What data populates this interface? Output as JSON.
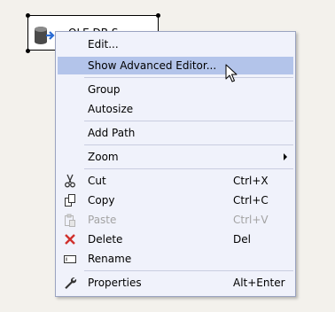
{
  "component": {
    "label": "OLE DB S"
  },
  "menu": {
    "edit": {
      "label": "Edit..."
    },
    "show_advanced_editor": {
      "label": "Show Advanced Editor..."
    },
    "group": {
      "label": "Group"
    },
    "autosize": {
      "label": "Autosize"
    },
    "add_path": {
      "label": "Add Path"
    },
    "zoom": {
      "label": "Zoom"
    },
    "cut": {
      "label": "Cut",
      "shortcut": "Ctrl+X"
    },
    "copy": {
      "label": "Copy",
      "shortcut": "Ctrl+C"
    },
    "paste": {
      "label": "Paste",
      "shortcut": "Ctrl+V"
    },
    "delete": {
      "label": "Delete",
      "shortcut": "Del"
    },
    "rename": {
      "label": "Rename"
    },
    "properties": {
      "label": "Properties",
      "shortcut": "Alt+Enter"
    }
  },
  "colors": {
    "menu_background": "#f0f2fb",
    "highlight": "#b3c4ea",
    "delete_icon": "#d0312d",
    "disabled_text": "#a3a3a3"
  }
}
